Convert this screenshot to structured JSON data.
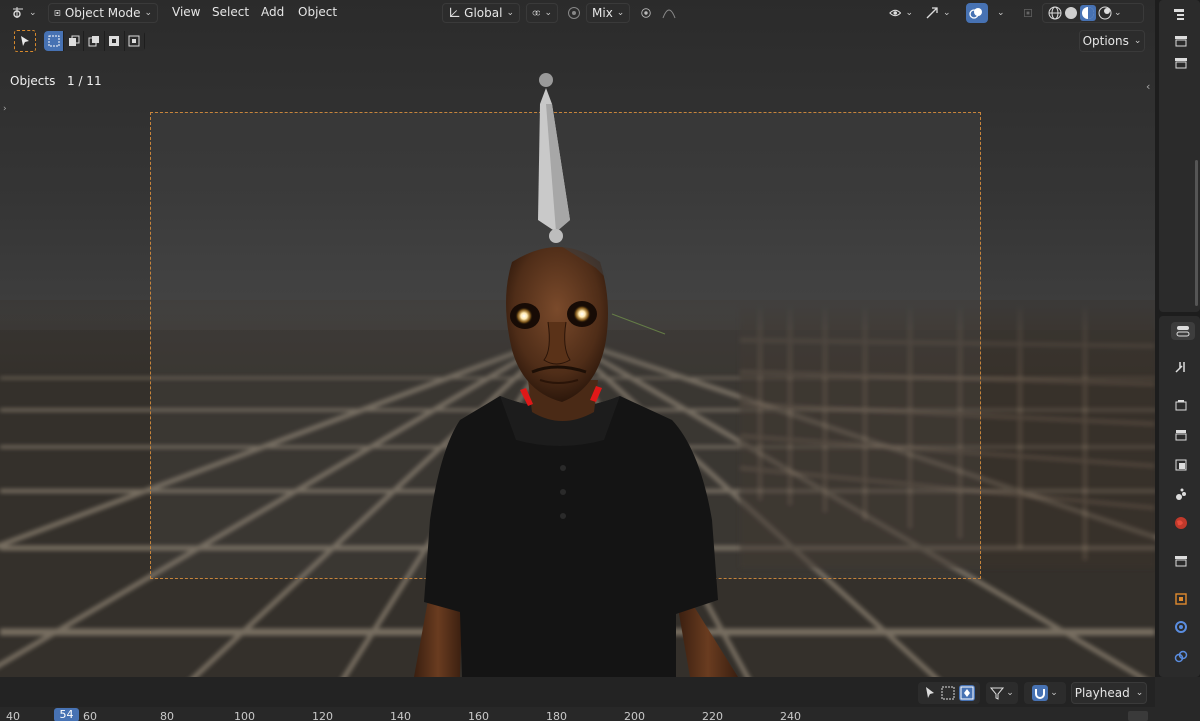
{
  "header": {
    "editor_type_icon": "editor-type-icon",
    "mode_label": "Object Mode",
    "menus": [
      "View",
      "Select",
      "Add",
      "Object"
    ],
    "transform_orientation": "Global",
    "proportional_falloff": "Mix",
    "options_label": "Options"
  },
  "overlay": {
    "objects_label": "Objects",
    "objects_count": "1 / 11"
  },
  "timeline": {
    "playhead_label": "Playhead",
    "current_frame": "54",
    "ticks": [
      "40",
      "60",
      "80",
      "100",
      "120",
      "140",
      "160",
      "180",
      "200",
      "220",
      "240"
    ]
  },
  "colors": {
    "accent": "#4772b3",
    "camera_frame": "#c7843b",
    "viewport_bg": "#353535",
    "panel_bg": "#2b2b2b"
  }
}
